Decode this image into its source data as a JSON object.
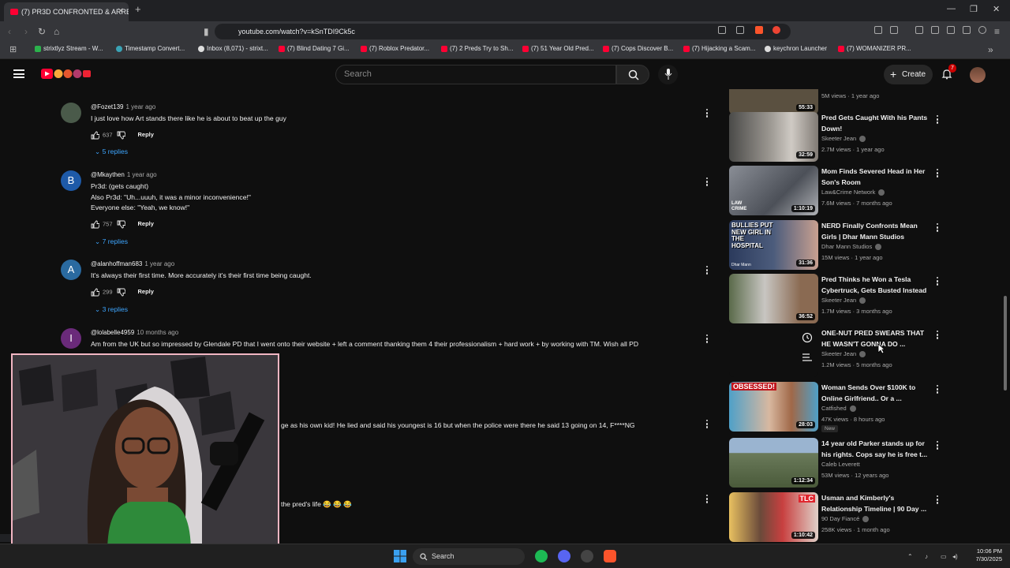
{
  "browser": {
    "tab_title": "(7) PR3D CONFRONTED & ARRE",
    "url": "youtube.com/watch?v=kSnTDI9Ck5c",
    "bookmarks": [
      {
        "label": "strixtlyz Stream - W...",
        "kind": "g"
      },
      {
        "label": "Timestamp Convert...",
        "kind": "t"
      },
      {
        "label": "Inbox (8,071) - strixt...",
        "kind": "k"
      },
      {
        "label": "(7) Blind Dating 7 Gi...",
        "kind": "y"
      },
      {
        "label": "(7) Roblox Predator...",
        "kind": "y"
      },
      {
        "label": "(7) 2 Preds Try to Sh...",
        "kind": "y"
      },
      {
        "label": "(7) 51 Year Old Pred...",
        "kind": "y"
      },
      {
        "label": "(7) Cops Discover B...",
        "kind": "y"
      },
      {
        "label": "(7) Hijacking a Scam...",
        "kind": "y"
      },
      {
        "label": "keychron Launcher",
        "kind": "k"
      },
      {
        "label": "(7) WOMANIZER PR...",
        "kind": "y"
      }
    ]
  },
  "youtube": {
    "search_placeholder": "Search",
    "create_label": "Create",
    "notification_count": "7"
  },
  "comments": [
    {
      "author": "@Fozet139",
      "date": "1 year ago",
      "avatar_letter": "",
      "avatar_color": "#4a5a4a",
      "lines": [
        "I just love how Art stands there like he is about to beat up the guy"
      ],
      "likes": "637",
      "reply_label": "Reply",
      "replies": "5 replies"
    },
    {
      "author": "@Mkaythen",
      "date": "1 year ago",
      "avatar_letter": "B",
      "avatar_color": "#1e5aa8",
      "lines": [
        "Pr3d: (gets caught)",
        "Also Pr3d: \"Uh...uuuh, it was a minor inconvenience!\"",
        "Everyone else: \"Yeah, we know!\""
      ],
      "likes": "757",
      "reply_label": "Reply",
      "replies": "7 replies"
    },
    {
      "author": "@alanhoffman683",
      "date": "1 year ago",
      "avatar_letter": "A",
      "avatar_color": "#2a6aa0",
      "lines": [
        "It's always their first time. More accurately it's their first time being caught."
      ],
      "likes": "299",
      "reply_label": "Reply",
      "replies": "3 replies"
    },
    {
      "author": "@lolabelle4959",
      "date": "10 months ago",
      "avatar_letter": "I",
      "avatar_color": "#6a2a7a",
      "lines": [
        "Am from the UK but so impressed by Glendale PD that I went onto their website + left a comment thanking them 4 their professionalism + hard work + by working with TM. Wish all PD"
      ],
      "likes": "",
      "reply_label": "",
      "replies": ""
    }
  ],
  "partial_comments": [
    "ge as his own kid! He lied and said his youngest is 16 but when the police were there he said 13 going on 14, F****NG",
    "the pred's life 😂 😂 😂"
  ],
  "recommendations": [
    {
      "title": "",
      "channel": "",
      "meta": "5M views · 1 year ago",
      "duration": "55:33",
      "thumb": "#5a5040",
      "new": ""
    },
    {
      "title": "Pred Gets Caught With his Pants Down!",
      "channel": "Skeeter Jean",
      "meta": "2.7M views · 1 year ago",
      "duration": "32:59",
      "thumb": "#8a8680",
      "new": ""
    },
    {
      "title": "Mom Finds Severed Head in Her Son's Room",
      "channel": "Law&Crime Network",
      "meta": "7.6M views · 7 months ago",
      "duration": "1:10:19",
      "thumb": "#6f7580",
      "new": ""
    },
    {
      "title": "NERD Finally Confronts Mean Girls | Dhar Mann Studios",
      "channel": "Dhar Mann Studios",
      "meta": "15M views · 1 year ago",
      "duration": "31:36",
      "thumb": "#3a4a6a",
      "new": ""
    },
    {
      "title": "Pred Thinks he Won a Tesla Cybertruck, Gets Busted Instead",
      "channel": "Skeeter Jean",
      "meta": "1.7M views · 3 months ago",
      "duration": "36:52",
      "thumb": "#7a7060",
      "new": ""
    },
    {
      "title": "ONE-NUT PRED SWEARS THAT HE WASN'T GONNA DO ...",
      "channel": "Skeeter Jean",
      "meta": "1.2M views · 5 months ago",
      "duration": "",
      "thumb": "#0f0f0f",
      "new": ""
    },
    {
      "title": "Woman Sends Over $100K to Online Girlfriend.. Or a ...",
      "channel": "Catfished",
      "meta": "47K views · 8 hours ago",
      "duration": "28:03",
      "thumb": "#8a7a6a",
      "new": "New"
    },
    {
      "title": "14 year old Parker stands up for his rights. Cops say he is free t...",
      "channel": "Caleb Leverett",
      "meta": "53M views · 12 years ago",
      "duration": "1:12:34",
      "thumb": "#6a7a5a",
      "new": ""
    },
    {
      "title": "Usman and Kimberly's Relationship Timeline | 90 Day ...",
      "channel": "90 Day Fiancé",
      "meta": "258K views · 1 month ago",
      "duration": "1:10:42",
      "thumb": "#6a4a3a",
      "new": ""
    }
  ],
  "thumb_texts": {
    "lawcrime": "LAW CRIME",
    "bullies": "BULLIES PUT NEW GIRL IN THE HOSPITAL",
    "dharmann": "Dhar Mann",
    "obsessed": "OBSESSED!",
    "tlc": "TLC"
  },
  "taskbar": {
    "search_label": "Search",
    "time": "10:06 PM",
    "date": "7/30/2025"
  }
}
